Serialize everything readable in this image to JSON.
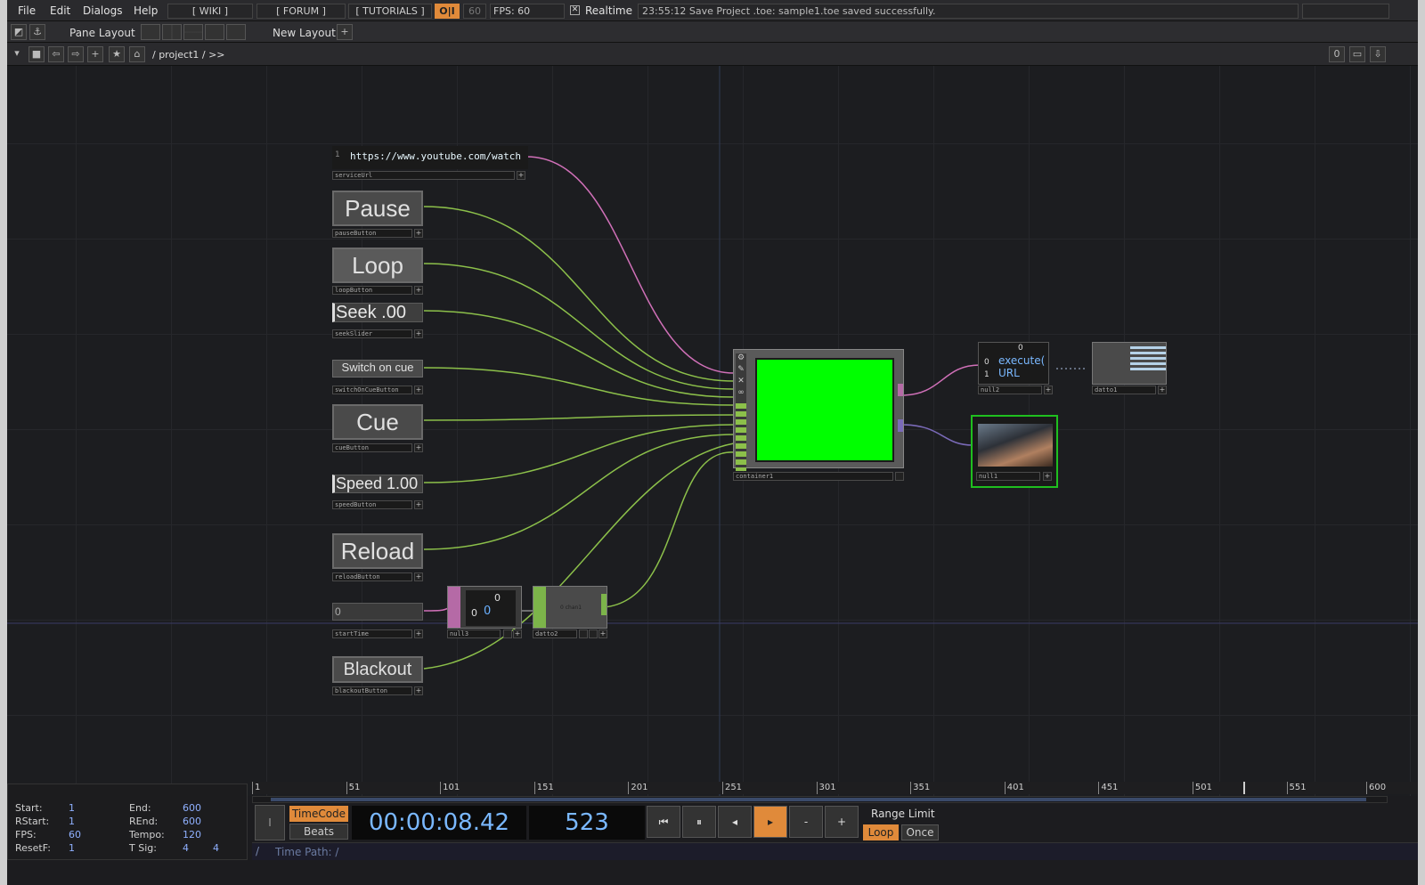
{
  "menu": {
    "items": [
      "File",
      "Edit",
      "Dialogs",
      "Help"
    ],
    "wiki": "[ WIKI ]",
    "forum": "[ FORUM ]",
    "tutorials": "[ TUTORIALS ]",
    "oi_badge": "O|I",
    "fps_target": "60",
    "fps_label": "FPS:  60",
    "realtime": "Realtime",
    "status": "23:55:12 Save Project .toe: sample1.toe saved successfully."
  },
  "toolbar": {
    "pane_layout": "Pane Layout",
    "new_layout": "New Layout",
    "add": "+"
  },
  "path": {
    "crumbs": "/ project1 / >>",
    "right_index": "0"
  },
  "nodes": {
    "serviceUrl": {
      "line_no": "1",
      "text": "https://www.youtube.com/watch",
      "label": "serviceUrl"
    },
    "pauseButton": {
      "text": "Pause",
      "label": "pauseButton"
    },
    "loopButton": {
      "text": "Loop",
      "label": "loopButton"
    },
    "seekSlider": {
      "text": "Seek  .00",
      "label": "seekSlider"
    },
    "switchOnCueButton": {
      "text": "Switch on cue",
      "label": "switchOnCueButton"
    },
    "cueButton": {
      "text": "Cue",
      "label": "cueButton"
    },
    "speedButton": {
      "text": "Speed 1.00",
      "label": "speedButton"
    },
    "reloadButton": {
      "text": "Reload",
      "label": "reloadButton"
    },
    "startTime": {
      "text": "0",
      "label": "startTime"
    },
    "blackoutButton": {
      "text": "Blackout",
      "label": "blackoutButton"
    },
    "null3": {
      "label": "null3",
      "v_top": "0",
      "v_left": "0",
      "v_main": "0"
    },
    "datto2": {
      "label": "datto2",
      "inner": "0 chan1"
    },
    "container1": {
      "label": "container1"
    },
    "null2": {
      "label": "null2",
      "header": "0",
      "row0_idx": "0",
      "row0_val": "execute(",
      "row1_idx": "1",
      "row1_val": "URL"
    },
    "datto1": {
      "label": "datto1"
    },
    "null1": {
      "label": "null1"
    }
  },
  "timeline": {
    "ticks": [
      "1",
      "51",
      "101",
      "151",
      "201",
      "251",
      "301",
      "351",
      "401",
      "451",
      "501",
      "551",
      "600"
    ],
    "start": {
      "k": "Start:",
      "v": "1"
    },
    "end": {
      "k": "End:",
      "v": "600"
    },
    "rstart": {
      "k": "RStart:",
      "v": "1"
    },
    "rend": {
      "k": "REnd:",
      "v": "600"
    },
    "fps": {
      "k": "FPS:",
      "v": "60"
    },
    "tempo": {
      "k": "Tempo:",
      "v": "120"
    },
    "resetf": {
      "k": "ResetF:",
      "v": "1"
    },
    "tsig": {
      "k": "T Sig:",
      "v": "4",
      "v2": "4"
    },
    "timecode_btn": "TimeCode",
    "beats_btn": "Beats",
    "timecode": "00:00:08.42",
    "frame": "523",
    "range_limit": "Range Limit",
    "loop": "Loop",
    "once": "Once",
    "time_path": "Time Path: /",
    "minus": "-",
    "plus": "+"
  },
  "colors": {
    "accent_orange": "#e08a3a",
    "wire_green": "#8cc04a",
    "wire_pink": "#d070b8",
    "wire_purple": "#7a6ab8",
    "container_green": "#00ff00"
  }
}
